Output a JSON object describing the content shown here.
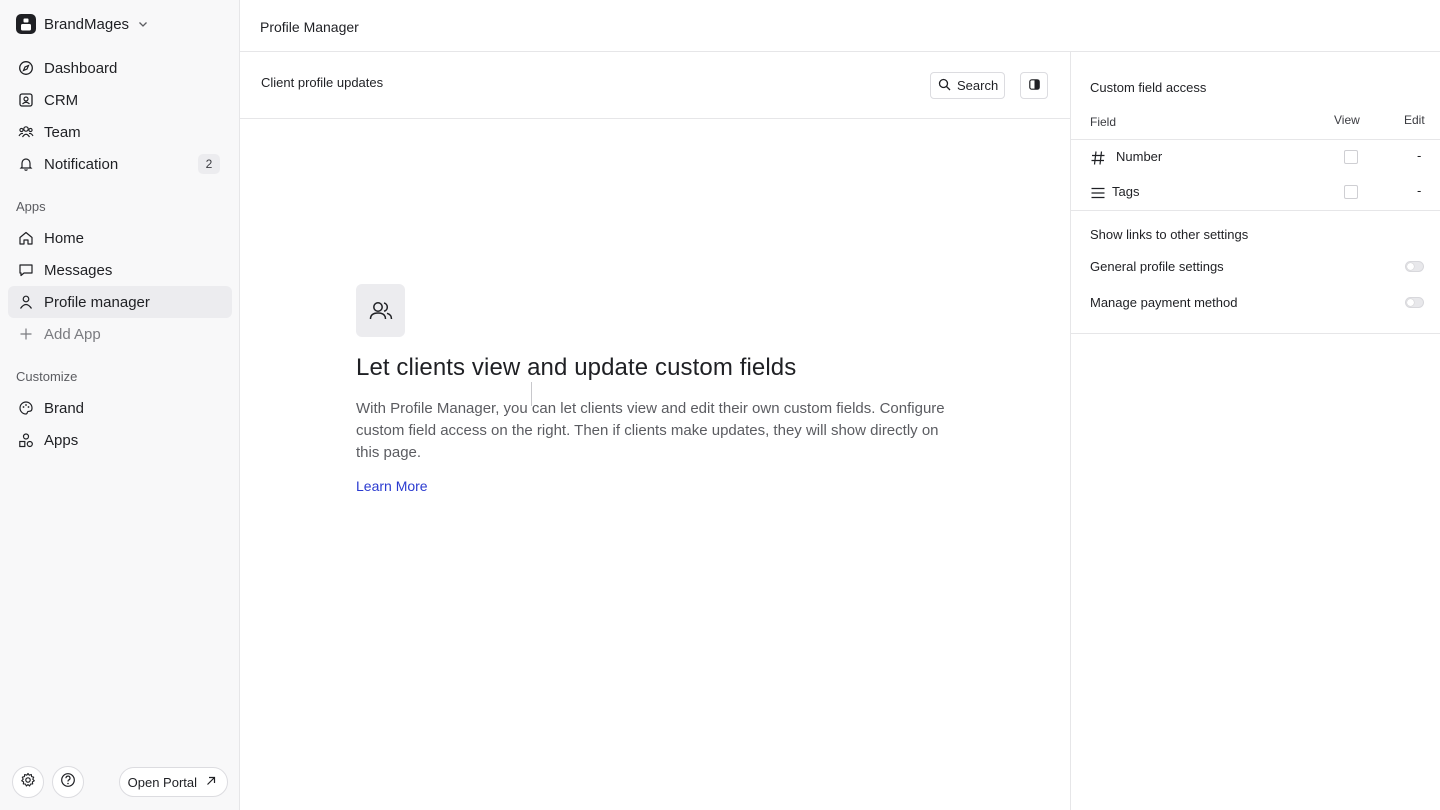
{
  "workspace": {
    "name": "BrandMages"
  },
  "nav": {
    "main": [
      {
        "label": "Dashboard",
        "icon": "dashboard-icon"
      },
      {
        "label": "CRM",
        "icon": "crm-icon"
      },
      {
        "label": "Team",
        "icon": "team-icon"
      },
      {
        "label": "Notification",
        "icon": "bell-icon",
        "badge": "2"
      }
    ],
    "apps_label": "Apps",
    "apps": [
      {
        "label": "Home",
        "icon": "home-icon"
      },
      {
        "label": "Messages",
        "icon": "messages-icon"
      },
      {
        "label": "Profile manager",
        "icon": "user-icon",
        "active": true
      },
      {
        "label": "Add App",
        "icon": "plus-icon"
      }
    ],
    "customize_label": "Customize",
    "customize": [
      {
        "label": "Brand",
        "icon": "palette-icon"
      },
      {
        "label": "Apps",
        "icon": "shapes-icon"
      }
    ]
  },
  "footer": {
    "open_portal_label": "Open Portal"
  },
  "header": {
    "title": "Profile Manager"
  },
  "main": {
    "section_title": "Client profile updates",
    "search_label": "Search",
    "empty_state": {
      "heading": "Let clients view and update custom fields",
      "body": "With Profile Manager, you can let clients view and edit their own custom fields. Configure custom field access on the right. Then if clients make updates, they will show directly on this page.",
      "link": "Learn More"
    }
  },
  "panel": {
    "title": "Custom field access",
    "columns": {
      "field": "Field",
      "view": "View",
      "edit": "Edit"
    },
    "fields": [
      {
        "name": "Number",
        "icon": "hash-icon",
        "view": false,
        "edit": "-"
      },
      {
        "name": "Tags",
        "icon": "list-icon",
        "view": false,
        "edit": "-"
      }
    ],
    "links_title": "Show links to other settings",
    "links": [
      {
        "label": "General profile settings",
        "enabled": false
      },
      {
        "label": "Manage payment method",
        "enabled": false
      }
    ]
  },
  "colors": {
    "accent_link": "#2b3bd0",
    "active_bg": "#ececef",
    "sidebar_bg": "#f8f8f9"
  }
}
